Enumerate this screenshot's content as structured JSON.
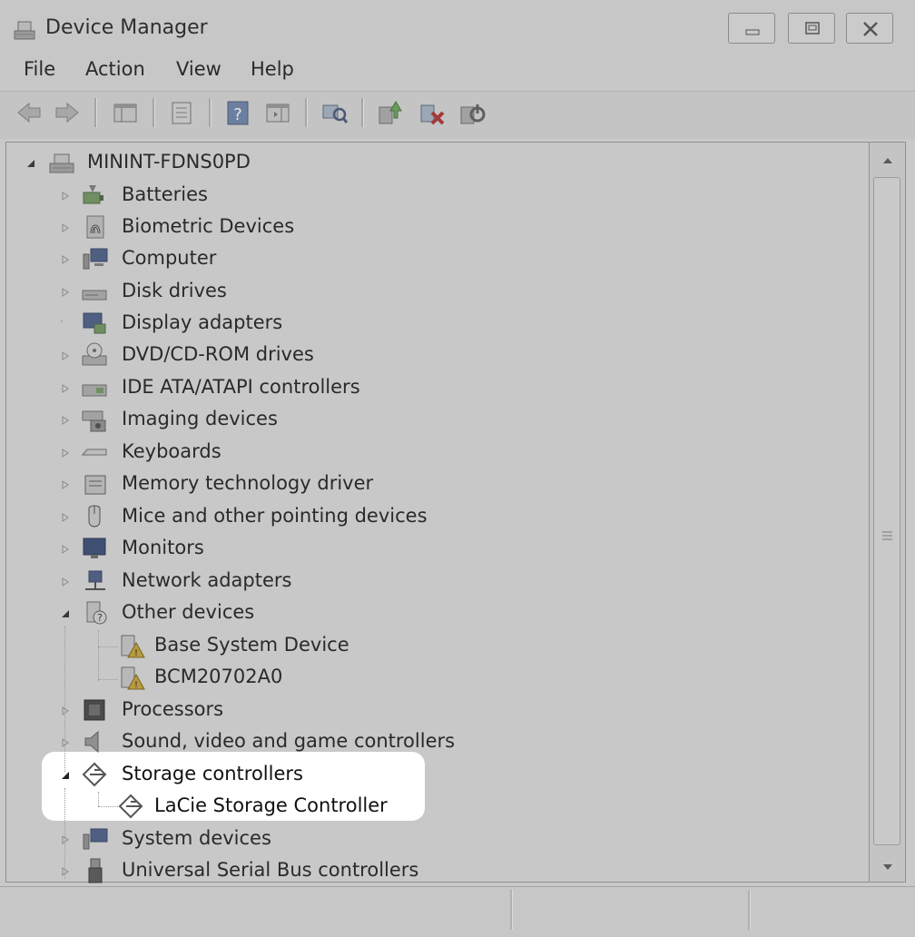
{
  "window": {
    "title": "Device Manager",
    "controls": [
      "minimize",
      "restore",
      "close"
    ]
  },
  "menu": [
    "File",
    "Action",
    "View",
    "Help"
  ],
  "toolbar": [
    "back-arrow-icon",
    "forward-arrow-icon",
    "show-hide-console-tree-icon",
    "properties-icon",
    "help-icon",
    "action-pane-icon",
    "scan-hardware-icon",
    "update-driver-icon",
    "uninstall-device-icon",
    "enable-device-icon"
  ],
  "tree": {
    "root": "MININT-FDNS0PD",
    "categories": [
      {
        "label": "Batteries",
        "icon": "battery-icon",
        "expanded": false
      },
      {
        "label": "Biometric Devices",
        "icon": "fingerprint-icon",
        "expanded": false
      },
      {
        "label": "Computer",
        "icon": "computer-icon",
        "expanded": false
      },
      {
        "label": "Disk drives",
        "icon": "disk-drive-icon",
        "expanded": false
      },
      {
        "label": "Display adapters",
        "icon": "display-adapter-icon",
        "expanded": false
      },
      {
        "label": "DVD/CD-ROM drives",
        "icon": "dvd-drive-icon",
        "expanded": false
      },
      {
        "label": "IDE ATA/ATAPI controllers",
        "icon": "ide-controller-icon",
        "expanded": false
      },
      {
        "label": "Imaging devices",
        "icon": "camera-icon",
        "expanded": false
      },
      {
        "label": "Keyboards",
        "icon": "keyboard-icon",
        "expanded": false
      },
      {
        "label": "Memory technology driver",
        "icon": "memory-card-icon",
        "expanded": false
      },
      {
        "label": "Mice and other pointing devices",
        "icon": "mouse-icon",
        "expanded": false
      },
      {
        "label": "Monitors",
        "icon": "monitor-icon",
        "expanded": false
      },
      {
        "label": "Network adapters",
        "icon": "network-adapter-icon",
        "expanded": false
      },
      {
        "label": "Other devices",
        "icon": "unknown-device-icon",
        "expanded": true,
        "children": [
          {
            "label": "Base System Device",
            "icon": "warning-device-icon"
          },
          {
            "label": "BCM20702A0",
            "icon": "warning-device-icon"
          }
        ]
      },
      {
        "label": "Processors",
        "icon": "processor-icon",
        "expanded": false
      },
      {
        "label": "Sound, video and game controllers",
        "icon": "speaker-icon",
        "expanded": false
      },
      {
        "label": "Storage controllers",
        "icon": "storage-controller-icon",
        "expanded": true,
        "children": [
          {
            "label": "LaCie Storage Controller",
            "icon": "storage-controller-icon"
          }
        ]
      },
      {
        "label": "System devices",
        "icon": "system-devices-icon",
        "expanded": false
      },
      {
        "label": "Universal Serial Bus controllers",
        "icon": "usb-icon",
        "expanded": false
      }
    ]
  },
  "colors": {
    "dimmed_background": "#c8c8c8",
    "highlight_background": "#ffffff"
  }
}
